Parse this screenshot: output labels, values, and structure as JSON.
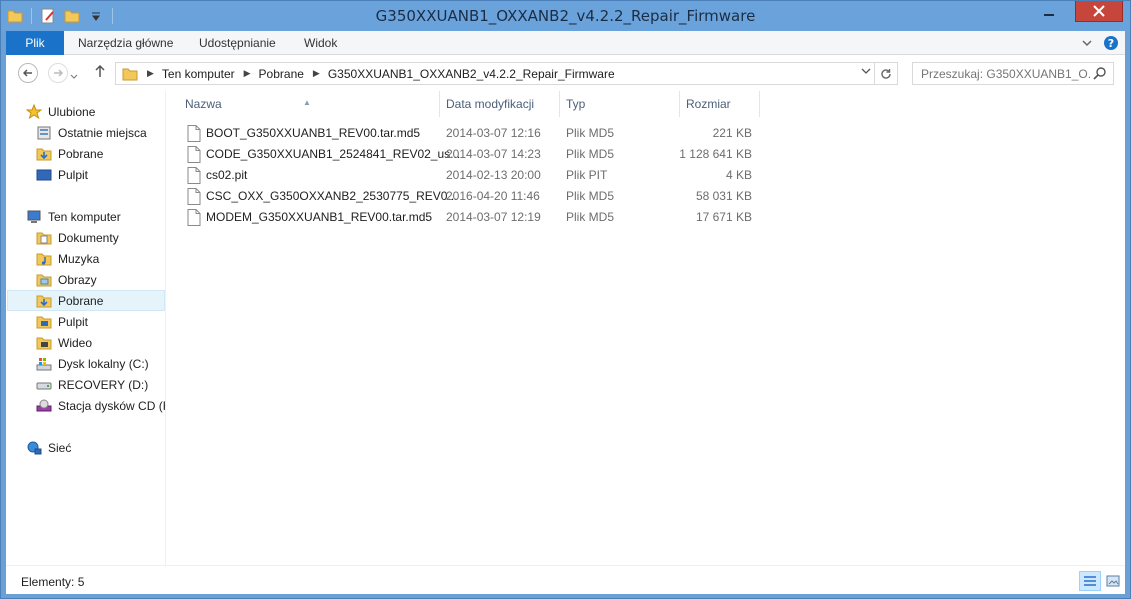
{
  "window": {
    "title": "G350XXUANB1_OXXANB2_v4.2.2_Repair_Firmware",
    "colors": {
      "titlebar": "#6aa3dc",
      "accent": "#1a73c8",
      "close": "#c7463b",
      "selection": "#e5f3fb"
    }
  },
  "ribbon": {
    "tabs": [
      {
        "label": "Plik"
      },
      {
        "label": "Narzędzia główne"
      },
      {
        "label": "Udostępnianie"
      },
      {
        "label": "Widok"
      }
    ]
  },
  "address": {
    "crumbs": [
      "Ten komputer",
      "Pobrane",
      "G350XXUANB1_OXXANB2_v4.2.2_Repair_Firmware"
    ]
  },
  "search": {
    "placeholder": "Przeszukaj: G350XXUANB1_O..."
  },
  "nav": {
    "favorites_label": "Ulubione",
    "favorites": [
      {
        "label": "Ostatnie miejsca",
        "icon": "recent-places-icon"
      },
      {
        "label": "Pobrane",
        "icon": "downloads-icon"
      },
      {
        "label": "Pulpit",
        "icon": "desktop-icon"
      }
    ],
    "computer_label": "Ten komputer",
    "computer": [
      {
        "label": "Dokumenty",
        "icon": "documents-icon"
      },
      {
        "label": "Muzyka",
        "icon": "music-icon"
      },
      {
        "label": "Obrazy",
        "icon": "pictures-icon"
      },
      {
        "label": "Pobrane",
        "icon": "downloads-icon",
        "selected": true
      },
      {
        "label": "Pulpit",
        "icon": "desktop-icon"
      },
      {
        "label": "Wideo",
        "icon": "videos-icon"
      },
      {
        "label": "Dysk lokalny (C:)",
        "icon": "local-disk-icon"
      },
      {
        "label": "RECOVERY (D:)",
        "icon": "drive-icon"
      },
      {
        "label": "Stacja dysków CD (F",
        "icon": "cd-drive-icon"
      }
    ],
    "network_label": "Sieć"
  },
  "columns": {
    "name": "Nazwa",
    "date": "Data modyfikacji",
    "type": "Typ",
    "size": "Rozmiar"
  },
  "files": [
    {
      "name": "BOOT_G350XXUANB1_REV00.tar.md5",
      "date": "2014-03-07 12:16",
      "type": "Plik MD5",
      "size": "221 KB"
    },
    {
      "name": "CODE_G350XXUANB1_2524841_REV02_us...",
      "date": "2014-03-07 14:23",
      "type": "Plik MD5",
      "size": "1 128 641 KB"
    },
    {
      "name": "cs02.pit",
      "date": "2014-02-13 20:00",
      "type": "Plik PIT",
      "size": "4 KB"
    },
    {
      "name": "CSC_OXX_G350OXXANB2_2530775_REV0...",
      "date": "2016-04-20 11:46",
      "type": "Plik MD5",
      "size": "58 031 KB"
    },
    {
      "name": "MODEM_G350XXUANB1_REV00.tar.md5",
      "date": "2014-03-07 12:19",
      "type": "Plik MD5",
      "size": "17 671 KB"
    }
  ],
  "status": {
    "items_text": "Elementy: 5"
  }
}
